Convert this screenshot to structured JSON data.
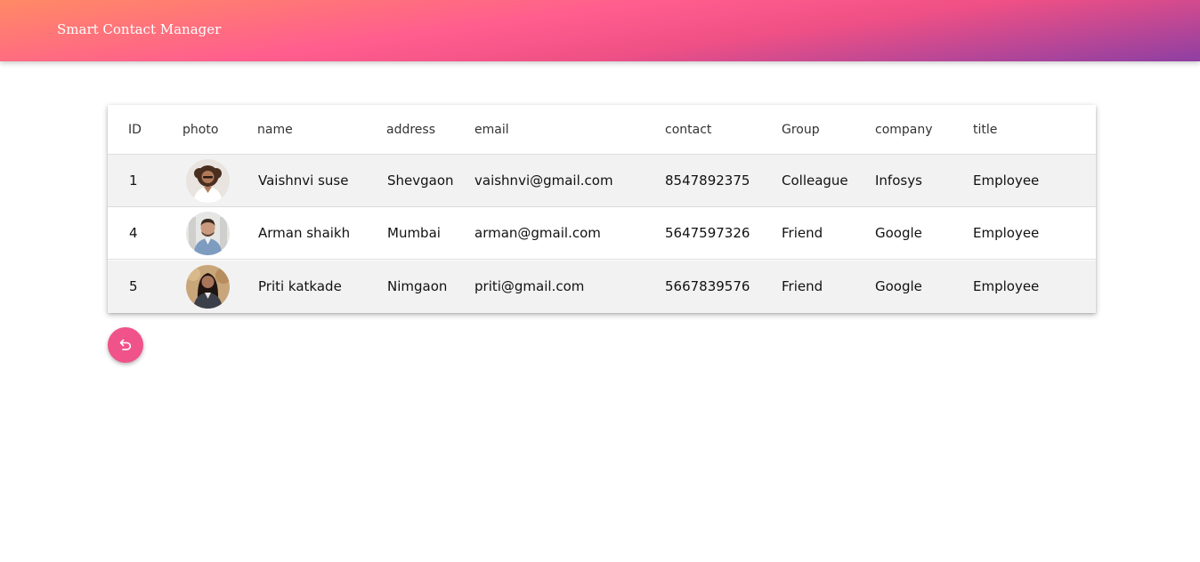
{
  "navbar": {
    "brand": "Smart Contact Manager",
    "gradient": [
      "#ff8a65",
      "#ff5e8e",
      "#8e3fa3"
    ]
  },
  "table": {
    "headers": {
      "id": "ID",
      "photo": "photo",
      "name": "name",
      "address": "address",
      "email": "email",
      "contact": "contact",
      "group": "Group",
      "company": "company",
      "title": "title"
    },
    "rows": [
      {
        "id": "1",
        "photo": "avatar-woman-curly-hair",
        "name": "Vaishnvi suse",
        "address": "Shevgaon",
        "email": "vaishnvi@gmail.com",
        "contact": "8547892375",
        "group": "Colleague",
        "company": "Infosys",
        "title": "Employee"
      },
      {
        "id": "4",
        "photo": "avatar-man-smiling",
        "name": "Arman shaikh",
        "address": "Mumbai",
        "email": "arman@gmail.com",
        "contact": "5647597326",
        "group": "Friend",
        "company": "Google",
        "title": "Employee"
      },
      {
        "id": "5",
        "photo": "avatar-woman-long-hair",
        "name": "Priti katkade",
        "address": "Nimgaon",
        "email": "priti@gmail.com",
        "contact": "5667839576",
        "group": "Friend",
        "company": "Google",
        "title": "Employee"
      }
    ]
  },
  "back_button": {
    "icon": "undo-icon",
    "color": "#f0528a"
  }
}
